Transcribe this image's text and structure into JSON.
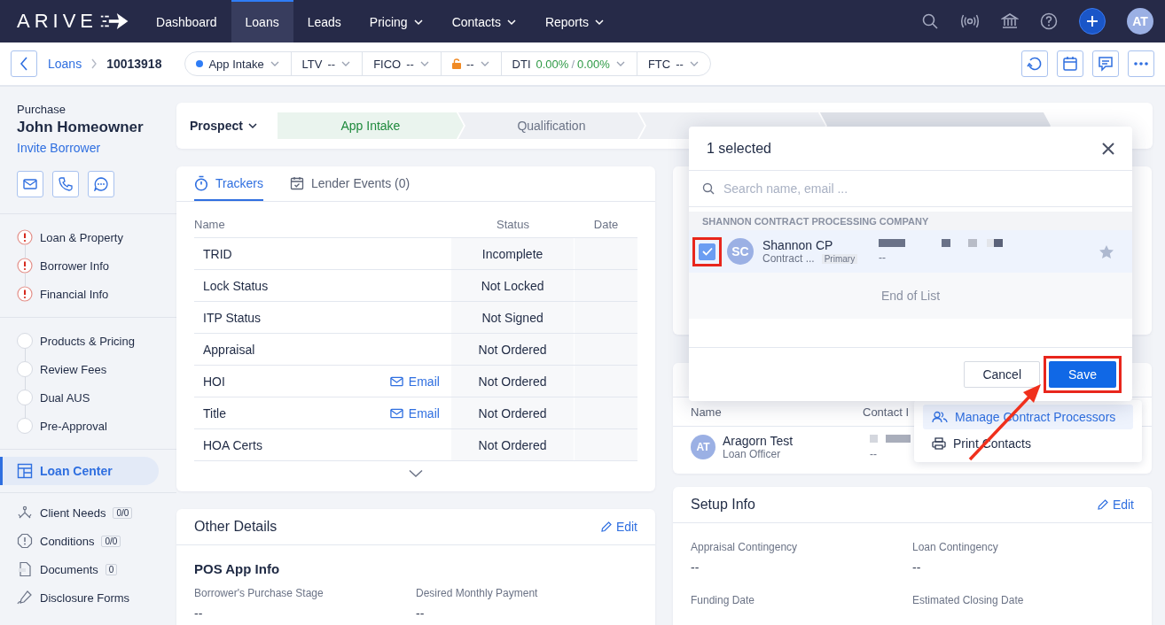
{
  "nav": {
    "logo": "ARIVE",
    "items": [
      {
        "label": "Dashboard",
        "selected": false,
        "dropdown": false
      },
      {
        "label": "Loans",
        "selected": true,
        "dropdown": false
      },
      {
        "label": "Leads",
        "selected": false,
        "dropdown": false
      },
      {
        "label": "Pricing",
        "selected": false,
        "dropdown": true
      },
      {
        "label": "Contacts",
        "selected": false,
        "dropdown": true
      },
      {
        "label": "Reports",
        "selected": false,
        "dropdown": true
      }
    ],
    "avatar": "AT"
  },
  "subbar": {
    "breadcrumb": [
      "Loans",
      "10013918"
    ],
    "pills": [
      {
        "kind": "stage",
        "label": "App Intake"
      },
      {
        "kind": "metric",
        "label": "LTV",
        "value": "--"
      },
      {
        "kind": "metric",
        "label": "FICO",
        "value": "--"
      },
      {
        "kind": "lock",
        "value": "--"
      },
      {
        "kind": "ratio",
        "label": "DTI",
        "values": [
          "0.00%",
          "0.00%"
        ],
        "separator": "/"
      },
      {
        "kind": "metric",
        "label": "FTC",
        "value": "--"
      }
    ]
  },
  "borrower": {
    "loan_type": "Purchase",
    "name": "John Homeowner",
    "invite": "Invite Borrower"
  },
  "sidebar": {
    "steps": [
      {
        "label": "Loan & Property",
        "warning": true
      },
      {
        "label": "Borrower Info",
        "warning": true
      },
      {
        "label": "Financial Info",
        "warning": true
      }
    ],
    "steps_2": [
      {
        "label": "Products & Pricing",
        "warning": false
      },
      {
        "label": "Review Fees",
        "warning": false
      },
      {
        "label": "Dual AUS",
        "warning": false
      },
      {
        "label": "Pre-Approval",
        "warning": false
      }
    ],
    "nav": [
      {
        "label": "Loan Center",
        "selected": true
      }
    ],
    "tools": [
      {
        "kind": "needs",
        "label": "Client Needs",
        "count": "0/0"
      },
      {
        "kind": "conditions",
        "label": "Conditions",
        "count": "0/0"
      },
      {
        "kind": "documents",
        "label": "Documents",
        "count": "0"
      },
      {
        "kind": "forms",
        "label": "Disclosure Forms"
      }
    ]
  },
  "stages": {
    "dropdown": "Prospect",
    "steps": [
      {
        "label": "App Intake",
        "selected": true
      },
      {
        "label": "Qualification",
        "selected": false
      }
    ]
  },
  "trackers": {
    "tabs": [
      {
        "label": "Trackers",
        "selected": true
      },
      {
        "label": "Lender Events (0)",
        "selected": false
      }
    ],
    "columns": [
      "Name",
      "Status",
      "Date"
    ],
    "rows": [
      {
        "name": "TRID",
        "status": "Incomplete"
      },
      {
        "name": "Lock Status",
        "status": "Not Locked"
      },
      {
        "name": "ITP Status",
        "status": "Not Signed"
      },
      {
        "name": "Appraisal",
        "status": "Not Ordered"
      },
      {
        "name": "HOI",
        "action": "Email",
        "status": "Not Ordered"
      },
      {
        "name": "Title",
        "action": "Email",
        "status": "Not Ordered"
      },
      {
        "name": "HOA Certs",
        "status": "Not Ordered"
      }
    ]
  },
  "other_details": {
    "title": "Other Details",
    "edit": "Edit",
    "section": "POS App Info",
    "fields": [
      {
        "label": "Borrower's Purchase Stage",
        "value": "--"
      },
      {
        "label": "Desired Monthly Payment",
        "value": "--"
      }
    ]
  },
  "contacts": {
    "columns": [
      "Name",
      "Contact I"
    ],
    "rows": [
      {
        "initials": "AT",
        "name": "Aragorn Test",
        "role": "Loan Officer",
        "value": "--"
      }
    ]
  },
  "contacts_menu": [
    {
      "label": "Manage Contract Processors",
      "selected": true
    },
    {
      "label": "Print Contacts",
      "selected": false
    }
  ],
  "setup_info": {
    "title": "Setup Info",
    "edit": "Edit",
    "fields": [
      {
        "label": "Appraisal Contingency",
        "value": "--"
      },
      {
        "label": "Loan Contingency",
        "value": "--"
      },
      {
        "label": "Funding Date"
      },
      {
        "label": "Estimated Closing Date"
      }
    ]
  },
  "modal": {
    "title": "1 selected",
    "search_placeholder": "Search name, email ...",
    "group": "SHANNON CONTRACT PROCESSING COMPANY",
    "rows": [
      {
        "checked": true,
        "initials": "SC",
        "name": "Shannon CP",
        "role": "Contract ...",
        "tag": "Primary",
        "value": "--",
        "starred": false
      }
    ],
    "end_note": "End of List",
    "buttons": [
      {
        "label": "Cancel",
        "kind": "secondary"
      },
      {
        "label": "Save",
        "kind": "primary"
      }
    ]
  }
}
